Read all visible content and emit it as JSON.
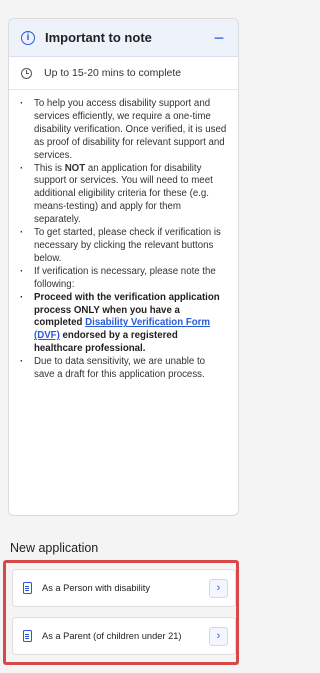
{
  "note": {
    "title": "Important to note",
    "collapse_symbol": "−",
    "time_text": "Up to 15-20 mins to complete",
    "bullets": {
      "b1": "To help you access disability support and services efficiently, we require a one-time disability verification. Once verified, it is used as proof of disability for relevant support and services.",
      "b2_pre": "This is ",
      "b2_bold": "NOT",
      "b2_post": " an application for disability support or services. You will need to meet additional eligibility criteria for these (e.g. means-testing) and apply for them separately.",
      "b3": "To get started, please check if verification is necessary by clicking the relevant buttons below.",
      "b4": "If verification is necessary, please note the following:",
      "b5_pre": "Proceed with the verification application process ONLY when you have a completed ",
      "b5_link": "Disability Verification Form (DVF)",
      "b5_post": " endorsed by a registered healthcare professional.",
      "b6": "Due to data sensitivity, we are unable to save a draft for this application process."
    }
  },
  "new_application": {
    "title": "New application",
    "options": [
      {
        "label": "As a Person with disability",
        "chevron": "›"
      },
      {
        "label": "As a Parent (of children under 21)",
        "chevron": "›"
      }
    ]
  },
  "colors": {
    "accent": "#2a5bd7",
    "highlight": "#d94848",
    "header_bg": "#eef2fb"
  },
  "icons": [
    "info-icon",
    "clock-icon",
    "document-icon",
    "chevron-right-icon"
  ]
}
